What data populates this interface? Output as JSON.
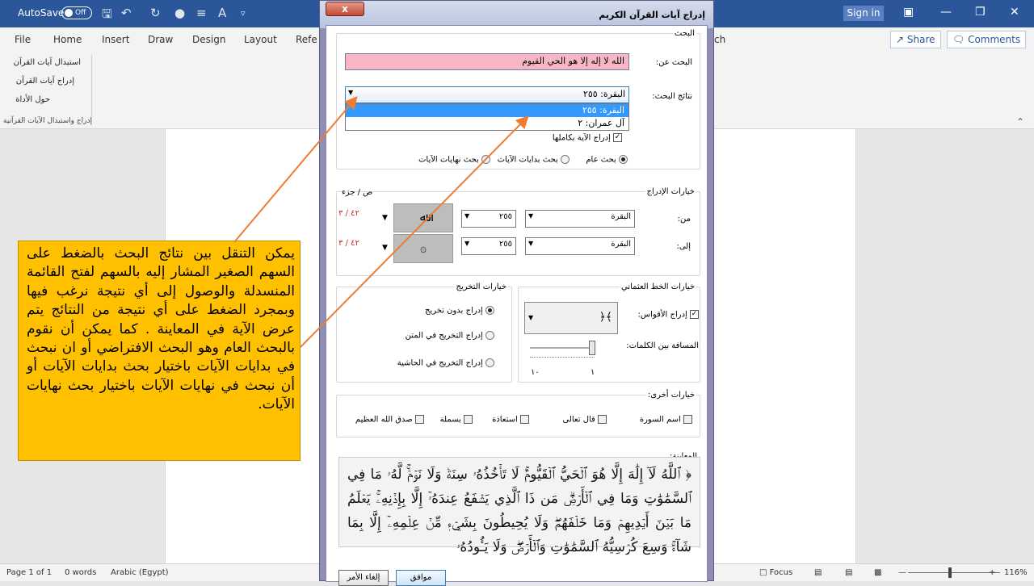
{
  "titlebar": {
    "autosave_label": "AutoSave",
    "autosave_state": "Off",
    "signin_label": "Sign in"
  },
  "ribbon_tabs": [
    "File",
    "Home",
    "Insert",
    "Draw",
    "Design",
    "Layout",
    "Refe",
    "ch"
  ],
  "share": {
    "share_label": "Share",
    "comments_label": "Comments"
  },
  "ribbon": {
    "cmd1": "استبدال آيات القرآن",
    "cmd2": "إدراج آيات القرآن",
    "cmd3": "حول الأداة",
    "group": "إدراج واستبدال الآيات القرآنية"
  },
  "status": {
    "page": "Page 1 of 1",
    "words": "0 words",
    "lang": "Arabic (Egypt)",
    "focus": "Focus",
    "zoom": "116%"
  },
  "callout": {
    "text": "يمكن التنقل بين نتائج البحث بالضغط على السهم الصغير المشار إليه بالسهم لفتح القائمة المنسدلة والوصول إلى أي نتيجة نرغب فيها وبمجرد الضغط على أي نتيجة من النتائج يتم عرض الآية في المعاينة . كما يمكن أن نقوم بالبحث العام وهو البحث الافتراضي أو ان نبحث في بدايات الآيات باختيار بحث بدايات الآيات أو أن نبحث في نهايات الآيات باختيار بحث نهايات الآيات."
  },
  "dialog": {
    "title": "إدراج آيات القرآن الكريم",
    "close": "x",
    "search_group": "البحث",
    "search_label": "البحث عن:",
    "search_value": "الله لا إله إلا هو الحي القيوم",
    "results_label": "نتائج البحث:",
    "results_selected": "البقرة: ٢٥٥",
    "results_options": [
      "البقرة: ٢٥٥",
      "آل عمران: ٢"
    ],
    "full_verse_label": "إدراج الآية بكاملها",
    "search_modes": [
      "بحث عام",
      "بحث بدايات الآيات",
      "بحث نهايات الآيات"
    ],
    "insert_group": "خيارات الإدراج",
    "page_part": "ص / جزء",
    "from_label": "من:",
    "to_label": "إلى:",
    "from_surah": "البقرة",
    "from_ayah": "٢٥٥",
    "from_page": "٤٢ / ٣",
    "to_surah": "البقرة",
    "to_ayah": "٢٥٥",
    "to_page": "٤٢ / ٣",
    "glyph_from": "ﷲ",
    "glyph_to": "۞",
    "ottoman_group": "خيارات الخط العثماني",
    "brackets_label": "إدراج الأقواس:",
    "brackets_glyph": "﴾﴿",
    "spacing_label": "المسافة بين الكلمات:",
    "slider_min": "١",
    "slider_max": "١٠",
    "takhrij_group": "خيارات التخريج",
    "takhrij_options": [
      "إدراج بدون تخريج",
      "إدراج التخريج في المتن",
      "إدراج التخريج في الحاشية"
    ],
    "other_group": "خيارات أخرى:",
    "other_options": [
      "اسم السورة",
      "قال تعالى",
      "استعاذة",
      "بسملة",
      "صدق الله العظيم"
    ],
    "preview_group": "المعاينة:",
    "preview_text": "﴿ ٱللَّهُ لَآ إِلَٰهَ إِلَّا هُوَ ٱلۡحَيُّ ٱلۡقَيُّومُۚ لَا تَأۡخُذُهُۥ سِنَةٞ وَلَا نَوۡمٞۚ لَّهُۥ مَا فِي ٱلسَّمَٰوَٰتِ وَمَا فِي ٱلۡأَرۡضِۗ مَن ذَا ٱلَّذِي يَشۡفَعُ عِندَهُۥٓ إِلَّا بِإِذۡنِهِۦۚ يَعۡلَمُ مَا بَيۡنَ أَيۡدِيهِمۡ وَمَا خَلۡفَهُمۡۖ وَلَا يُحِيطُونَ بِشَيۡءٖ مِّنۡ عِلۡمِهِۦٓ إِلَّا بِمَا شَآءَۚ وَسِعَ كُرۡسِيُّهُ ٱلسَّمَٰوَٰتِ وَٱلۡأَرۡضَۖ وَلَا يَـُٔودُهُۥ",
    "ok": "موافق",
    "cancel": "إلغاء الأمر"
  },
  "colors": {
    "word_blue": "#2b579a",
    "callout": "#ffc000",
    "arrow": "#ed7d31",
    "search_bg": "#f7b6c6",
    "highlight": "#3399ff"
  }
}
